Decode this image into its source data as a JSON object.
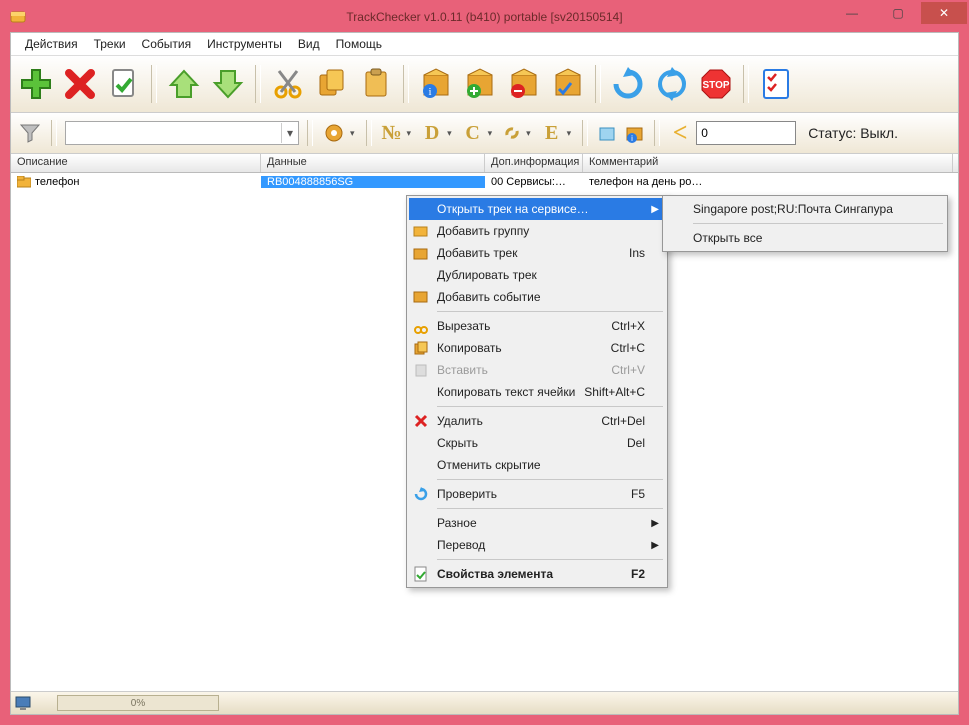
{
  "title": "TrackChecker v1.0.11 (b410)  portable [sv20150514]",
  "menu": {
    "items": [
      "Действия",
      "Треки",
      "События",
      "Инструменты",
      "Вид",
      "Помощь"
    ]
  },
  "toolbar2": {
    "numbox": "0",
    "status_label": "Статус: Выкл."
  },
  "columns": [
    "Описание",
    "Данные",
    "Доп.информация",
    "Комментарий"
  ],
  "row": {
    "desc": "телефон",
    "data": "RB004888856SG",
    "extra": "00 Сервисы:…",
    "comment": "телефон на день ро…"
  },
  "ctx": {
    "open_service": "Открыть трек на сервисе…",
    "add_group": "Добавить группу",
    "add_track": "Добавить трек",
    "add_track_sc": "Ins",
    "dup_track": "Дублировать трек",
    "add_event": "Добавить событие",
    "cut": "Вырезать",
    "cut_sc": "Ctrl+X",
    "copy": "Копировать",
    "copy_sc": "Ctrl+C",
    "paste": "Вставить",
    "paste_sc": "Ctrl+V",
    "copy_cell": "Копировать текст ячейки",
    "copy_cell_sc": "Shift+Alt+C",
    "delete": "Удалить",
    "delete_sc": "Ctrl+Del",
    "hide": "Скрыть",
    "hide_sc": "Del",
    "unhide": "Отменить скрытие",
    "check": "Проверить",
    "check_sc": "F5",
    "misc": "Разное",
    "translate": "Перевод",
    "props": "Свойства элемента",
    "props_sc": "F2"
  },
  "sub": {
    "item": "Singapore post;RU:Почта Сингапура",
    "open_all": "Открыть все"
  },
  "progress": "0%"
}
